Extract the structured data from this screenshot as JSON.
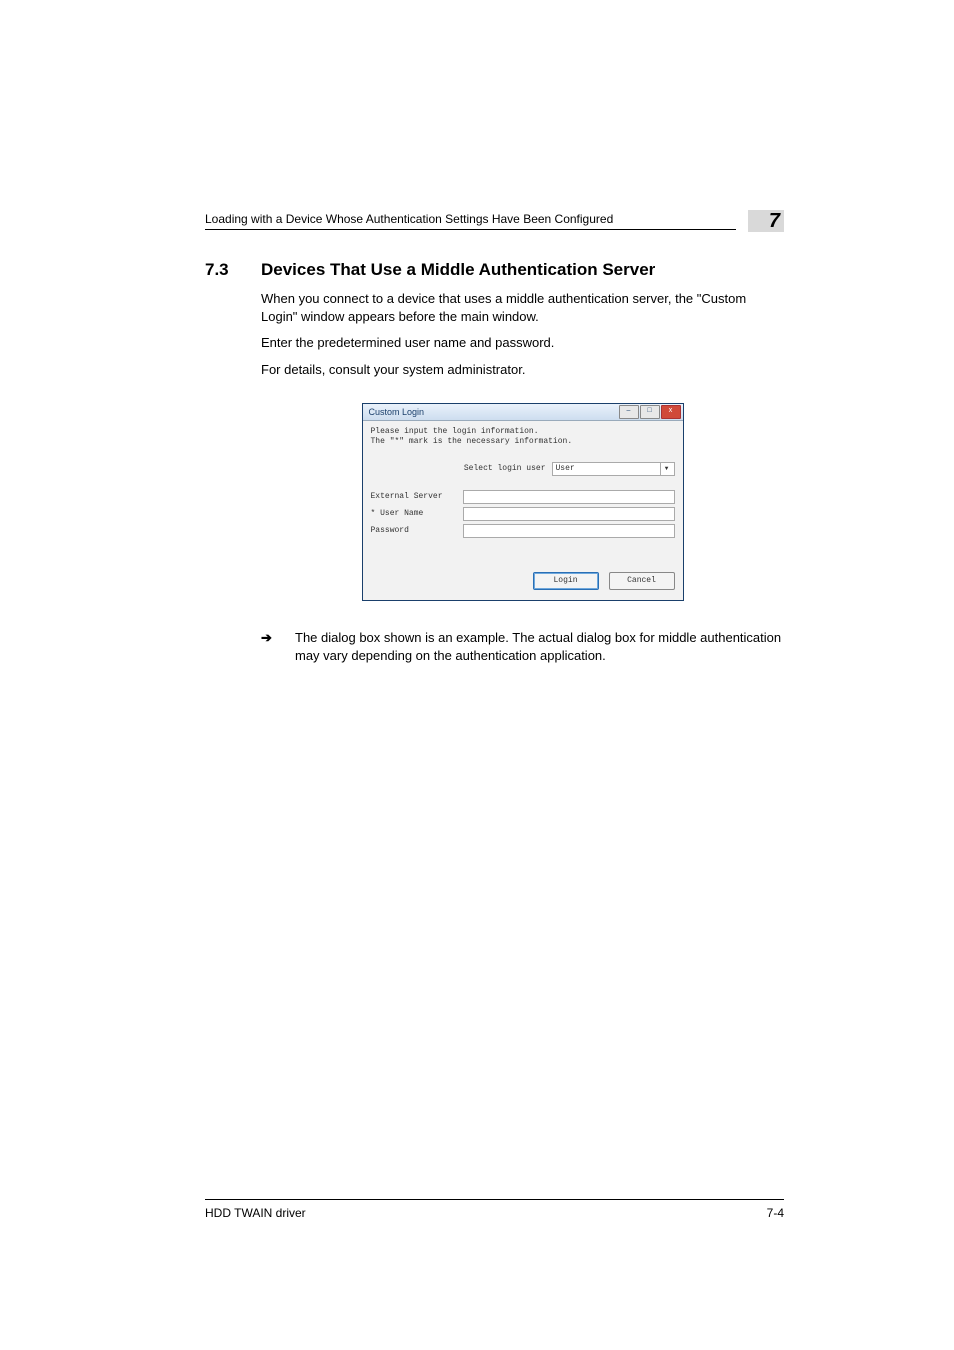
{
  "header": {
    "running": "Loading with a Device Whose Authentication Settings Have Been Configured",
    "chapnum": "7"
  },
  "section": {
    "num": "7.3",
    "title": "Devices That Use a Middle Authentication Server"
  },
  "paras": {
    "p1": "When you connect to a device that uses a middle authentication server, the \"Custom Login\" window appears before the main window.",
    "p2": "Enter the predetermined user name and password.",
    "p3": "For details, consult your system administrator."
  },
  "dialog": {
    "title": "Custom Login",
    "msg_l1": "Please input the login information.",
    "msg_l2": "The \"*\" mark is the necessary information.",
    "select_label": "Select login user",
    "select_value": "User",
    "lab_ext": "External Server",
    "lab_user": "* User Name",
    "lab_pass": "Password",
    "btn_login": "Login",
    "btn_cancel": "Cancel"
  },
  "note": {
    "arrow": "➔",
    "text": "The dialog box shown is an example. The actual dialog box for middle authentication may vary depending on the authentication application."
  },
  "footer": {
    "left": "HDD TWAIN driver",
    "right": "7-4"
  }
}
